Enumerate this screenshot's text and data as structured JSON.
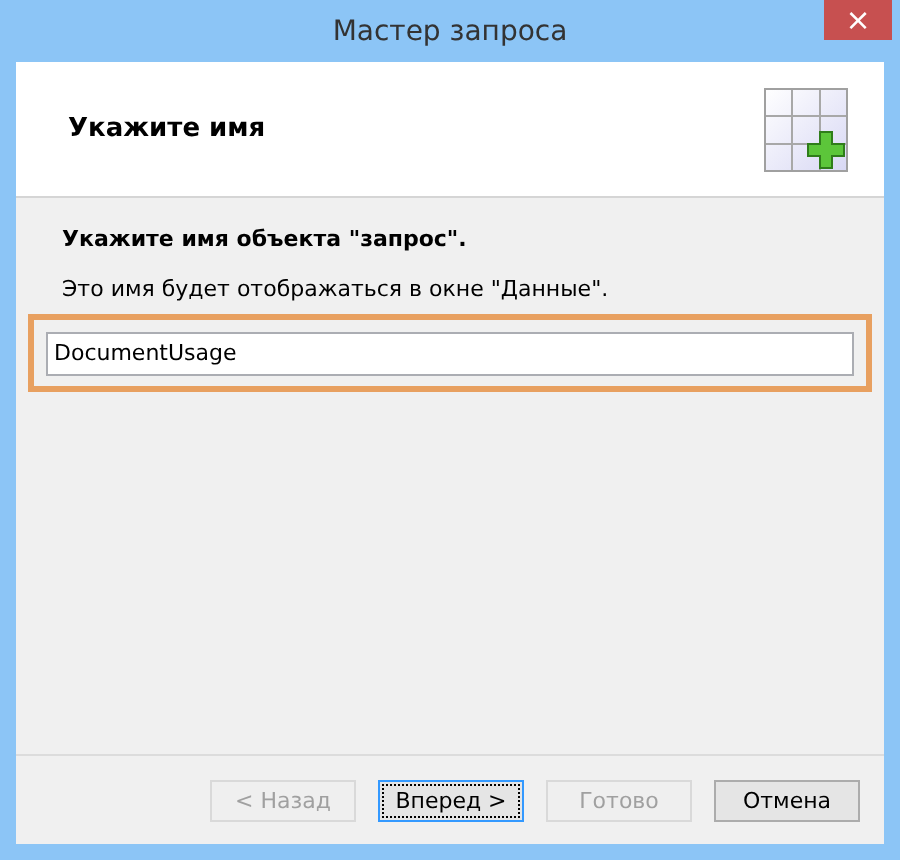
{
  "window": {
    "title": "Мастер запроса",
    "close_label": "×"
  },
  "header": {
    "title": "Укажите имя"
  },
  "prompt": "Укажите имя объекта \"запрос\".",
  "hint": "Это имя будет отображаться в окне \"Данные\".",
  "name_field": {
    "value": "DocumentUsage",
    "highlighted": true
  },
  "buttons": [
    {
      "label": "< Назад",
      "disabled": true,
      "focused": false
    },
    {
      "label": "Вперед >",
      "disabled": false,
      "focused": true
    },
    {
      "label": "Готово",
      "disabled": true,
      "focused": false
    },
    {
      "label": "Отмена",
      "disabled": false,
      "focused": false
    }
  ]
}
